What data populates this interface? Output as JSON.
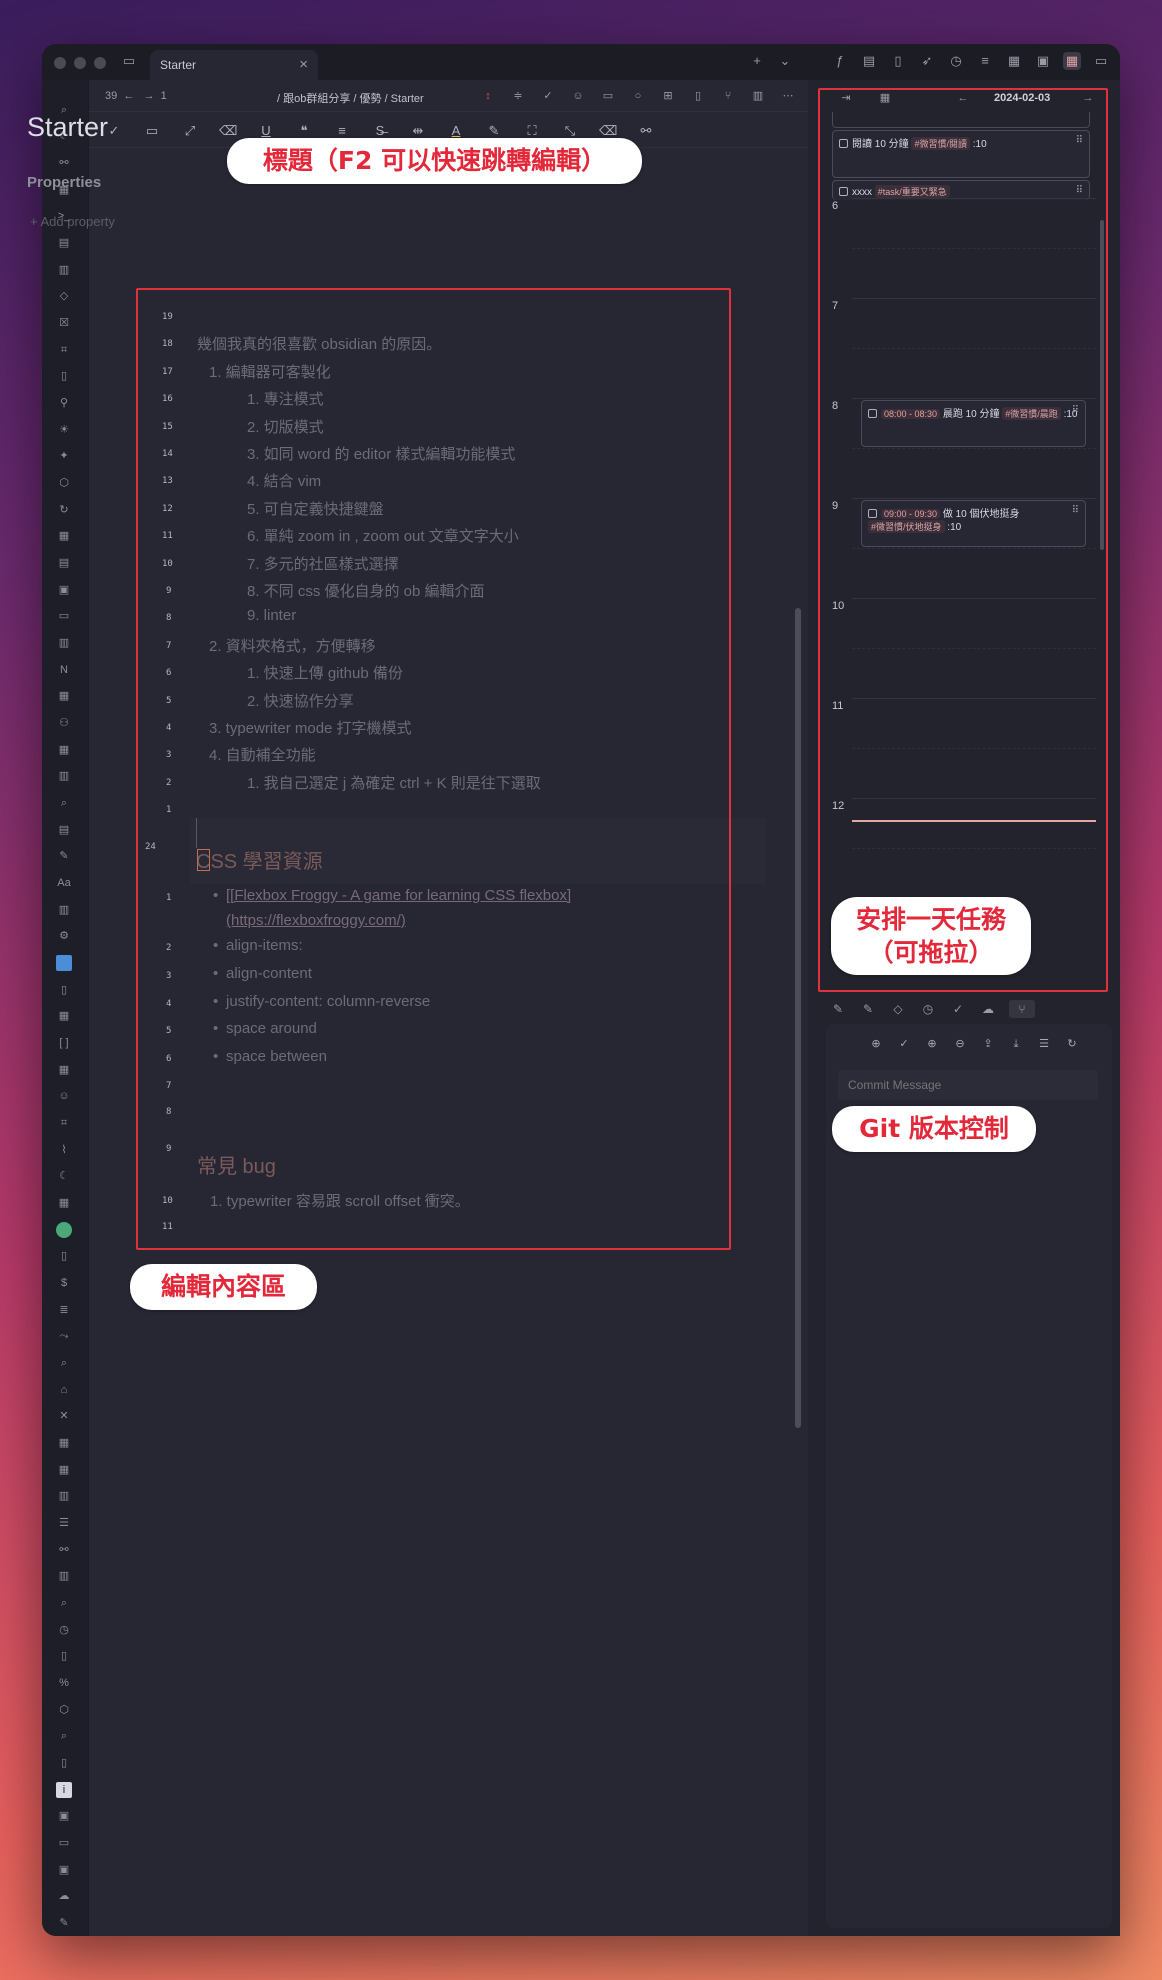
{
  "tab": {
    "title": "Starter",
    "close": "×"
  },
  "nav": {
    "count": "39",
    "forward": "1",
    "breadcrumb": "/ 跟ob群組分享 / 優勢 / Starter"
  },
  "document": {
    "title": "Starter",
    "properties_label": "Properties",
    "add_property": "+ Add property",
    "lines": [
      {
        "num": "19",
        "text": "",
        "indent": 0
      },
      {
        "num": "18",
        "text": "幾個我真的很喜歡 obsidian 的原因。",
        "indent": 0
      },
      {
        "num": "17",
        "text": "1. 編輯器可客製化",
        "indent": 1
      },
      {
        "num": "16",
        "text": "1. 專注模式",
        "indent": 2
      },
      {
        "num": "15",
        "text": "2. 切版模式",
        "indent": 2
      },
      {
        "num": "14",
        "text": "3. 如同 word 的 editor 樣式編輯功能模式",
        "indent": 2
      },
      {
        "num": "13",
        "text": "4. 結合 vim",
        "indent": 2
      },
      {
        "num": "12",
        "text": "5. 可自定義快捷鍵盤",
        "indent": 2
      },
      {
        "num": "11",
        "text": "6. 單純 zoom in , zoom out 文章文字大小",
        "indent": 2
      },
      {
        "num": "10",
        "text": "7. 多元的社區樣式選擇",
        "indent": 2
      },
      {
        "num": "9",
        "text": "8. 不同 css 優化自身的 ob 編輯介面",
        "indent": 2
      },
      {
        "num": "8",
        "text": "9. linter",
        "indent": 2
      },
      {
        "num": "7",
        "text": "2. 資料夾格式，方便轉移",
        "indent": 1
      },
      {
        "num": "6",
        "text": "1. 快速上傳 github 備份",
        "indent": 2
      },
      {
        "num": "5",
        "text": "2. 快速協作分享",
        "indent": 2
      },
      {
        "num": "4",
        "text": "3. typewriter mode 打字機模式",
        "indent": 1
      },
      {
        "num": "3",
        "text": "4. 自動補全功能",
        "indent": 1
      },
      {
        "num": "2",
        "text": "1. 我自己選定 j 為確定 ctrl + K 則是往下選取",
        "indent": 2
      },
      {
        "num": "1",
        "text": "",
        "indent": 0
      }
    ],
    "heading_css": {
      "num": "24",
      "text": "CSS 學習資源"
    },
    "css_items": [
      {
        "num": "1",
        "text": "[[Flexbox Froggy - A game for learning CSS flexbox]",
        "text2": "(https://flexboxfroggy.com/)",
        "link": true
      },
      {
        "num": "2",
        "text": "align-items:"
      },
      {
        "num": "3",
        "text": "align-content"
      },
      {
        "num": "4",
        "text": "justify-content: column-reverse"
      },
      {
        "num": "5",
        "text": "space around"
      },
      {
        "num": "6",
        "text": "space between"
      },
      {
        "num": "7",
        "text": ""
      },
      {
        "num": "8",
        "text": ""
      }
    ],
    "heading_bug": {
      "num": "9",
      "text": "常見 bug"
    },
    "bug_items": [
      {
        "num": "10",
        "text": "1. typewriter 容易跟 scroll offset 衝突。"
      },
      {
        "num": "11",
        "text": ""
      }
    ]
  },
  "calendar": {
    "date": "2024-02-03",
    "prev": "←",
    "next": "→",
    "all_day_tasks": [
      {
        "text": "閱讀 10 分鐘",
        "tag": "#微習慣/閱讀",
        "suffix": ":10"
      },
      {
        "text": "xxxx",
        "tag": "#task/重要又緊急",
        "suffix": ""
      }
    ],
    "hours": [
      "6",
      "7",
      "8",
      "9",
      "10",
      "11",
      "12"
    ],
    "events": [
      {
        "time": "08:00 - 08:30",
        "title": "晨跑 10 分鐘",
        "tag": "#微習慣/晨跑",
        "suffix": ":10"
      },
      {
        "time": "09:00 - 09:30",
        "title": "做 10 個伏地挺身",
        "tag": "#微習慣/伏地挺身",
        "suffix": ":10"
      }
    ]
  },
  "git": {
    "commit_placeholder": "Commit Message"
  },
  "annotations": {
    "title": "標題（F2 可以快速跳轉編輯）",
    "editor": "編輯內容區",
    "calendar_line1": "安排一天任務",
    "calendar_line2": "（可拖拉）",
    "git": "Git 版本控制"
  },
  "colors": {
    "annotation_red": "#e0323c",
    "background": "#22232d",
    "accent": "#e0a8a0"
  }
}
